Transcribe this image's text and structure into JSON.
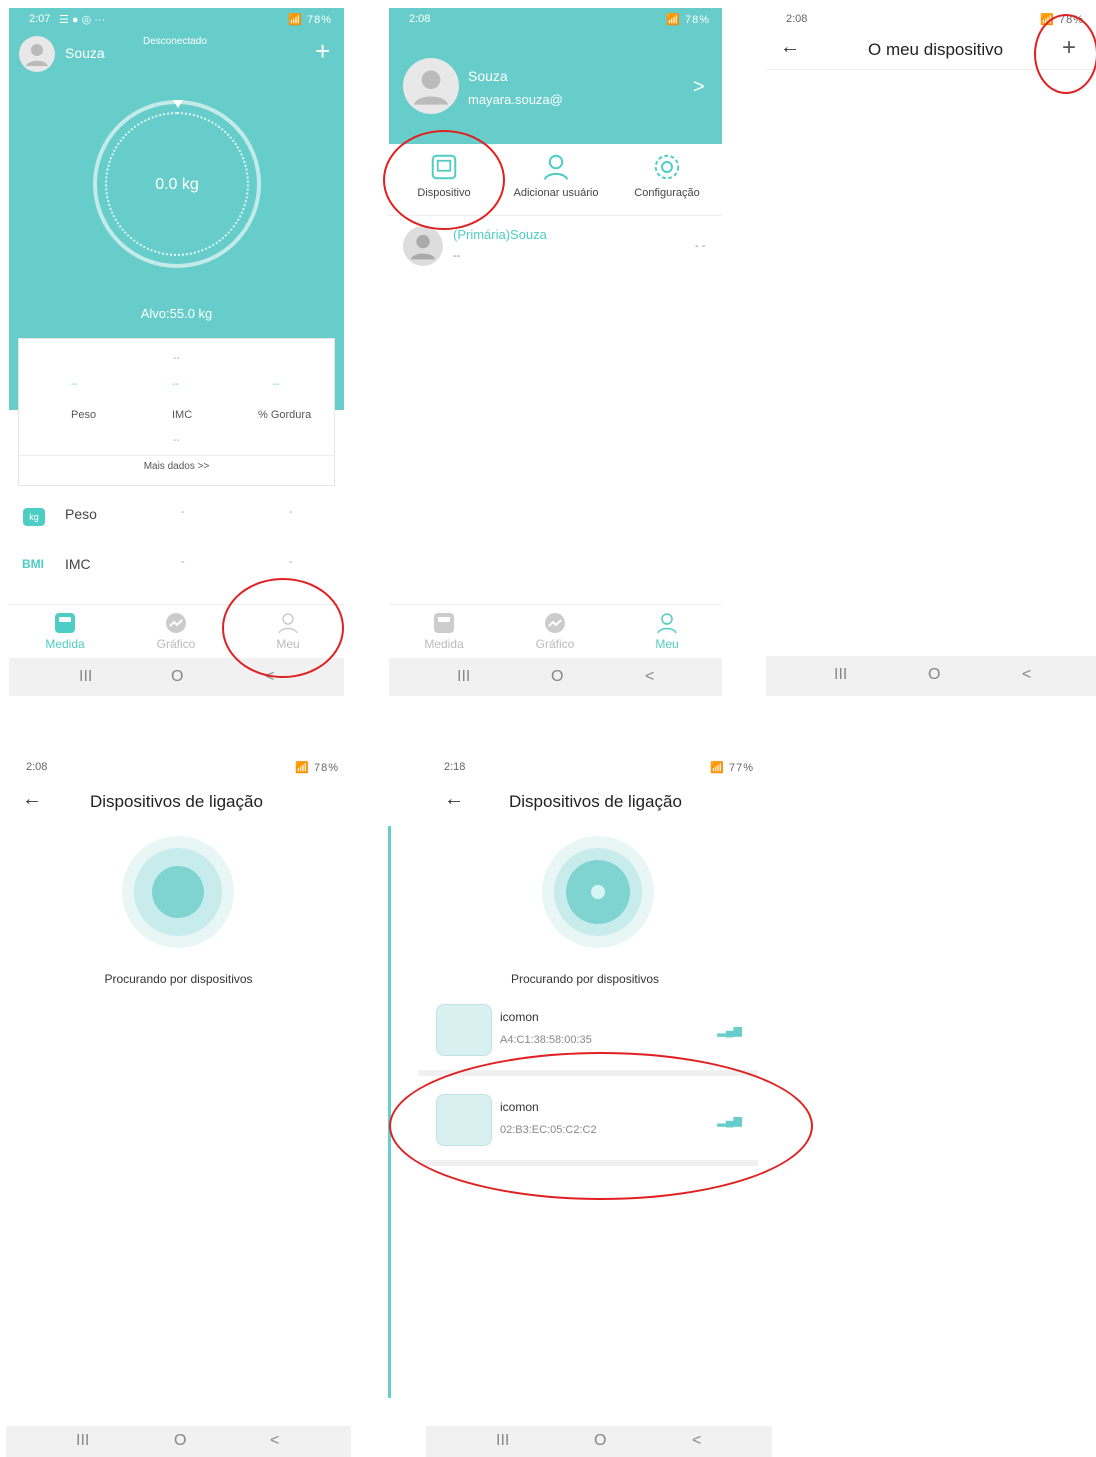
{
  "screen1": {
    "status_time": "2:07",
    "status_icons": "☰ ● ◎ ···",
    "status_right": "78%",
    "user_name": "Souza",
    "connection": "Desconectado",
    "add": "+",
    "weight": "0.0 kg",
    "target": "Alvo:55.0 kg",
    "stats": {
      "dash": "--",
      "peso": "Peso",
      "imc": "IMC",
      "gordura": "% Gordura",
      "more": "Mais dados >>"
    },
    "list": [
      {
        "icon": "kg",
        "label": "Peso",
        "v1": "-",
        "v2": "-"
      },
      {
        "icon": "BMI",
        "label": "IMC",
        "v1": "-",
        "v2": "-"
      }
    ],
    "nav": [
      "Medida",
      "Gráfico",
      "Meu"
    ],
    "sys": [
      "III",
      "O",
      "<"
    ]
  },
  "screen2": {
    "status_time": "2:08",
    "status_right": "78%",
    "user_name": "Souza",
    "email": "mayara.souza@",
    "chevron": ">",
    "actions": [
      "Dispositivo",
      "Adicionar usuário",
      "Configuração"
    ],
    "member_name": "(Primária)Souza",
    "member_dash": "--",
    "member_right": "- -",
    "nav": [
      "Medida",
      "Gráfico",
      "Meu"
    ],
    "sys": [
      "III",
      "O",
      "<"
    ]
  },
  "screen3": {
    "status_time": "2:08",
    "status_right": "78%",
    "back": "←",
    "title": "O meu dispositivo",
    "add": "+",
    "sys": [
      "III",
      "O",
      "<"
    ]
  },
  "screen4": {
    "status_time": "2:08",
    "status_right": "78%",
    "back": "←",
    "title": "Dispositivos de ligação",
    "searching": "Procurando por dispositivos",
    "sys": [
      "III",
      "O",
      "<"
    ]
  },
  "screen5": {
    "status_time": "2:18",
    "status_right": "77%",
    "back": "←",
    "title": "Dispositivos de ligação",
    "searching": "Procurando por dispositivos",
    "devices": [
      {
        "name": "icomon",
        "mac": "A4:C1:38:58:00:35"
      },
      {
        "name": "icomon",
        "mac": "02:B3:EC:05:C2:C2"
      }
    ],
    "sys": [
      "III",
      "O",
      "<"
    ]
  },
  "colors": {
    "teal": "#66cdca",
    "accent": "#4ecdc4",
    "annotation": "#e02020"
  }
}
